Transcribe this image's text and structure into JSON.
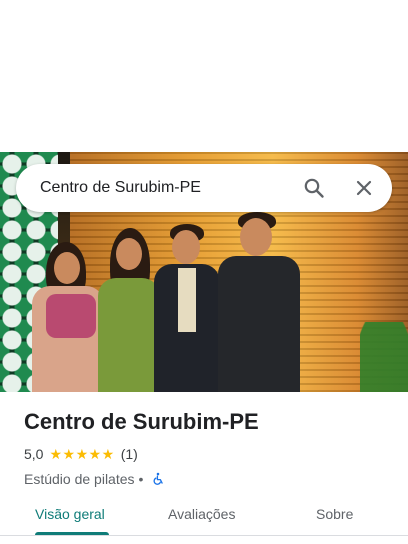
{
  "search": {
    "query": "Centro de Surubim-PE"
  },
  "icons": {
    "search": "search-icon",
    "close": "close-icon",
    "accessibility": "wheelchair-icon",
    "star": "star-icon"
  },
  "place": {
    "title": "Centro de Surubim-PE",
    "rating": "5,0",
    "stars": "★★★★★",
    "review_count": "(1)",
    "category": "Estúdio de pilates",
    "separator": "•"
  },
  "tabs": [
    {
      "label": "Visão geral",
      "active": true
    },
    {
      "label": "Avaliações",
      "active": false
    },
    {
      "label": "Sobre",
      "active": false
    }
  ],
  "colors": {
    "accent": "#0f7c78",
    "star": "#fbbc04",
    "wheelchair": "#1a73e8"
  }
}
